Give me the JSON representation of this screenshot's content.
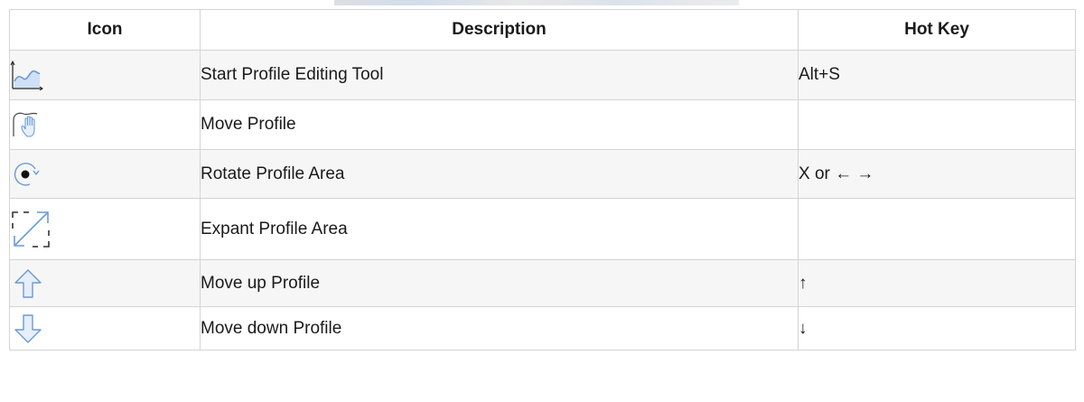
{
  "table": {
    "headers": {
      "icon": "Icon",
      "description": "Description",
      "hotkey": "Hot Key"
    },
    "rows": [
      {
        "icon": "profile-editing-icon",
        "description": "Start Profile Editing Tool",
        "hotkey": "Alt+S"
      },
      {
        "icon": "move-profile-hand-icon",
        "description": "Move Profile",
        "hotkey": ""
      },
      {
        "icon": "rotate-icon",
        "description": "Rotate Profile Area",
        "hotkey": "X or ← →"
      },
      {
        "icon": "expand-arrow-icon",
        "description": "Expant Profile Area",
        "hotkey": ""
      },
      {
        "icon": "arrow-up-icon",
        "description": "Move up Profile",
        "hotkey": "↑"
      },
      {
        "icon": "arrow-down-icon",
        "description": "Move down Profile",
        "hotkey": "↓"
      }
    ]
  },
  "colors": {
    "icon_blue": "#6a9ad6",
    "icon_fill": "#cfe0f6",
    "border": "#d4d4d4"
  }
}
